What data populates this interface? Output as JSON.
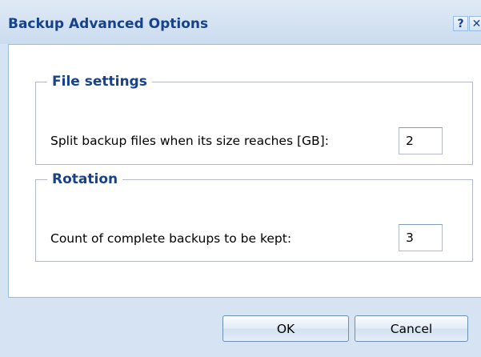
{
  "dialog": {
    "title": "Backup Advanced Options",
    "help_glyph": "?",
    "close_glyph": "✕"
  },
  "file_settings": {
    "legend": "File settings",
    "split_label": "Split backup files when its size reaches [GB]:",
    "split_value": "2"
  },
  "rotation": {
    "legend": "Rotation",
    "count_label": "Count of complete backups to be kept:",
    "count_value": "3"
  },
  "buttons": {
    "ok": "OK",
    "cancel": "Cancel"
  },
  "colors": {
    "title_text": "#15428b",
    "frame_bg": "#d6e3f2",
    "border": "#99bbe8"
  }
}
